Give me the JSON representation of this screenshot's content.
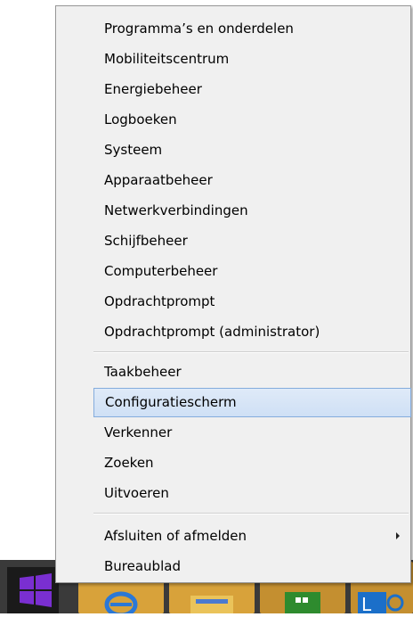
{
  "menu": {
    "group1": [
      "Programma’s en onderdelen",
      "Mobiliteitscentrum",
      "Energiebeheer",
      "Logboeken",
      "Systeem",
      "Apparaatbeheer",
      "Netwerkverbindingen",
      "Schijfbeheer",
      "Computerbeheer",
      "Opdrachtprompt",
      "Opdrachtprompt (administrator)"
    ],
    "group2": [
      "Taakbeheer",
      "Configuratiescherm",
      "Verkenner",
      "Zoeken",
      "Uitvoeren"
    ],
    "group3": [
      "Afsluiten of afmelden",
      "Bureaublad"
    ],
    "highlighted_item": "Configuratiescherm"
  },
  "taskbar": {
    "apps": [
      "internet-explorer-icon",
      "file-explorer-icon",
      "store-icon",
      "lync-icon"
    ]
  },
  "colors": {
    "menu_background": "#f0f0f0",
    "hover_fill": "#cfe0f5",
    "hover_border": "#84acdd",
    "taskbar_app": "#d8a23a",
    "windows_logo": "#7a2fd1"
  }
}
